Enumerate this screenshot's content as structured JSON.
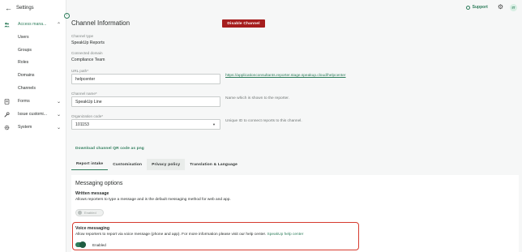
{
  "sidebar": {
    "back_label": "Settings",
    "sections": [
      {
        "label": "Access mana...",
        "icon": "users-icon",
        "chevron": "up",
        "expanded": true
      },
      {
        "label": "Forms",
        "icon": "forms-icon",
        "chevron": "down"
      },
      {
        "label": "Issue customi...",
        "icon": "wrench-icon",
        "chevron": "down"
      },
      {
        "label": "System",
        "icon": "gear-icon",
        "chevron": "down"
      }
    ],
    "subitems": [
      "Users",
      "Groups",
      "Roles",
      "Domains",
      "Channels"
    ]
  },
  "topbar": {
    "support_label": "Support",
    "avatar_initials": "IT"
  },
  "page": {
    "title": "Channel Information",
    "disable_button": "Disable Channel"
  },
  "fields": {
    "channel_type_label": "Channel type",
    "channel_type_value": "SpeakUp Reports",
    "connected_domain_label": "Connected domain",
    "connected_domain_value": "Compliance Team",
    "url_path_label": "URL path*",
    "url_path_value": "helpcenter",
    "url_link": "https://applicationconsultants.reporter.stage.speakup.cloud/helpcenter",
    "channel_name_label": "Channel name*",
    "channel_name_value": "SpeakUp Line",
    "channel_name_hint": "Name which is shown to the reporter.",
    "org_code_label": "Organization code*",
    "org_code_value": "101153",
    "org_code_hint": "Unique ID to connect reports to this channel."
  },
  "qr_link": "Download channel QR code as png",
  "tabs": [
    "Report intake",
    "Customisation",
    "Privacy policy",
    "Translation & Language"
  ],
  "messaging": {
    "title": "Messaging options",
    "written_title": "Written message",
    "written_desc": "Allows reporters to type a message and is the default messaging method for web and app.",
    "written_state": "Enabled",
    "voice_title": "Voice messaging",
    "voice_desc": "Allow reporters to report via voice message (phone and app). For more information please visit our help center.",
    "voice_link": "SpeakUp help center",
    "voice_state": "Enabled"
  },
  "colors": {
    "accent": "#2e7d5b",
    "danger": "#a51d1d",
    "highlight": "#d63b2f"
  }
}
